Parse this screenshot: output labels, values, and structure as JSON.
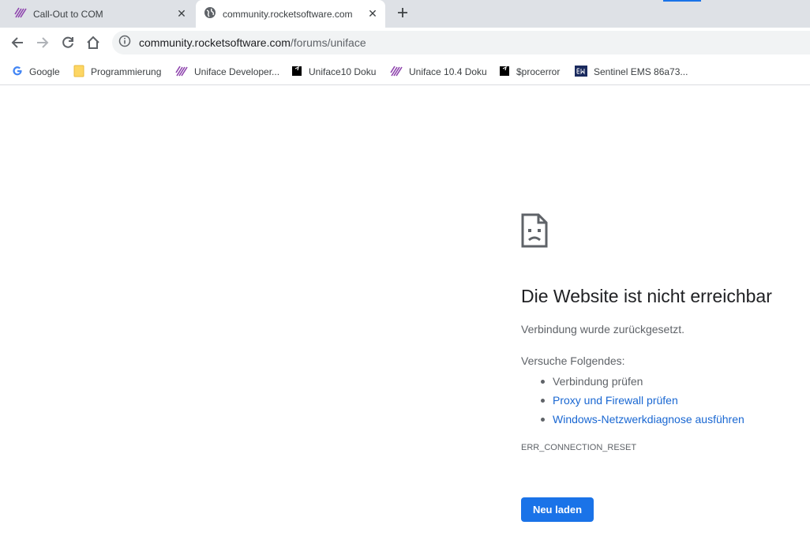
{
  "tabs": [
    {
      "title": "Call-Out to COM",
      "icon": "uniface-logo-icon",
      "active": false
    },
    {
      "title": "community.rocketsoftware.com",
      "icon": "globe-icon",
      "active": true
    }
  ],
  "toolbar": {
    "url_host": "community.rocketsoftware.com",
    "url_path": "/forums/uniface"
  },
  "bookmarks": [
    {
      "label": "Google",
      "icon": "google-icon"
    },
    {
      "label": "Programmierung",
      "icon": "folder-icon"
    },
    {
      "label": "Uniface Developer...",
      "icon": "uniface-logo-icon"
    },
    {
      "label": "Uniface10 Doku",
      "icon": "rocket-doc-icon"
    },
    {
      "label": "Uniface 10.4 Doku",
      "icon": "uniface-logo-icon"
    },
    {
      "label": "$procerror",
      "icon": "rocket-doc-icon"
    },
    {
      "label": "Sentinel EMS 86a73...",
      "icon": "ems-icon"
    }
  ],
  "error": {
    "title": "Die Website ist nicht erreichbar",
    "description": "Verbindung wurde zurückgesetzt.",
    "try_heading": "Versuche Folgendes:",
    "suggestions": [
      {
        "text": "Verbindung prüfen",
        "link": false
      },
      {
        "text": "Proxy und Firewall prüfen",
        "link": true
      },
      {
        "text": "Windows-Netzwerkdiagnose ausführen",
        "link": true
      }
    ],
    "code": "ERR_CONNECTION_RESET",
    "reload_label": "Neu laden"
  },
  "colors": {
    "accent": "#1a73e8",
    "link": "#1967d2",
    "tabstrip": "#dee1e6"
  }
}
